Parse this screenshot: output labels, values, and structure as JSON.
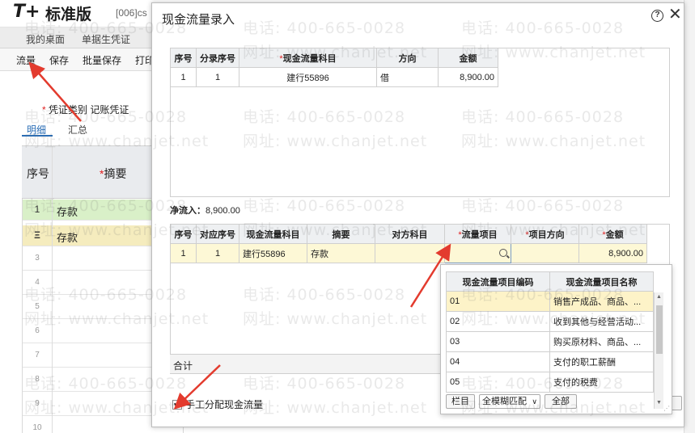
{
  "app": {
    "logo": "T+",
    "edition": "标准版",
    "account": "[006]cs",
    "tabs": [
      "我的桌面",
      "单据生凭证"
    ],
    "toolbar": [
      "流量",
      "保存",
      "批量保存",
      "打印"
    ],
    "voucher_type_label": "凭证类别",
    "voucher_type_value": "记账凭证",
    "detail_tab": "明细",
    "summary_tab": "汇总",
    "grid_header": {
      "seq": "序号",
      "summary": "摘要"
    },
    "grid_rows": [
      {
        "n": "1",
        "text": "存款"
      },
      {
        "n": "Ξ",
        "text": "存款"
      },
      {
        "n": "3",
        "text": ""
      },
      {
        "n": "4",
        "text": ""
      },
      {
        "n": "5",
        "text": ""
      },
      {
        "n": "6",
        "text": ""
      },
      {
        "n": "7",
        "text": ""
      },
      {
        "n": "8",
        "text": ""
      },
      {
        "n": "9",
        "text": ""
      },
      {
        "n": "10",
        "text": ""
      }
    ]
  },
  "modal": {
    "title": "现金流量录入",
    "top_table": {
      "headers": [
        "序号",
        "分录序号",
        "现金流量科目",
        "方向",
        "金额"
      ],
      "rows": [
        [
          "1",
          "1",
          "建行55896",
          "借",
          "8,900.00"
        ]
      ]
    },
    "net_inflow_label": "净流入：",
    "net_inflow_value": "8,900.00",
    "bottom_table": {
      "headers": [
        "序号",
        "对应序号",
        "现金流量科目",
        "摘要",
        "对方科目",
        "流量项目",
        "项目方向",
        "金额"
      ],
      "rows": [
        [
          "1",
          "1",
          "建行55896",
          "存款",
          "",
          "",
          "",
          "8,900.00"
        ]
      ]
    },
    "total_label": "合计",
    "manual_checkbox_label": "手工分配现金流量",
    "manual_checked": true
  },
  "dropdown": {
    "headers": [
      "现金流量项目编码",
      "现金流量项目名称"
    ],
    "rows": [
      [
        "01",
        "销售产成品、商品、..."
      ],
      [
        "02",
        "收到其他与经营活动..."
      ],
      [
        "03",
        "购买原材料、商品、..."
      ],
      [
        "04",
        "支付的职工薪酬"
      ],
      [
        "05",
        "支付的税费"
      ]
    ],
    "btn_columns": "栏目",
    "match_mode": "全模糊匹配",
    "btn_all": "全部"
  },
  "watermark": {
    "phone": "电话: 400-665-0028",
    "site": "网址: www.chanjet.net"
  },
  "colors": {
    "accent": "#2a6db5",
    "required": "#e02020",
    "arrow": "#e33b2e",
    "selected_row": "#fdf8d6"
  }
}
